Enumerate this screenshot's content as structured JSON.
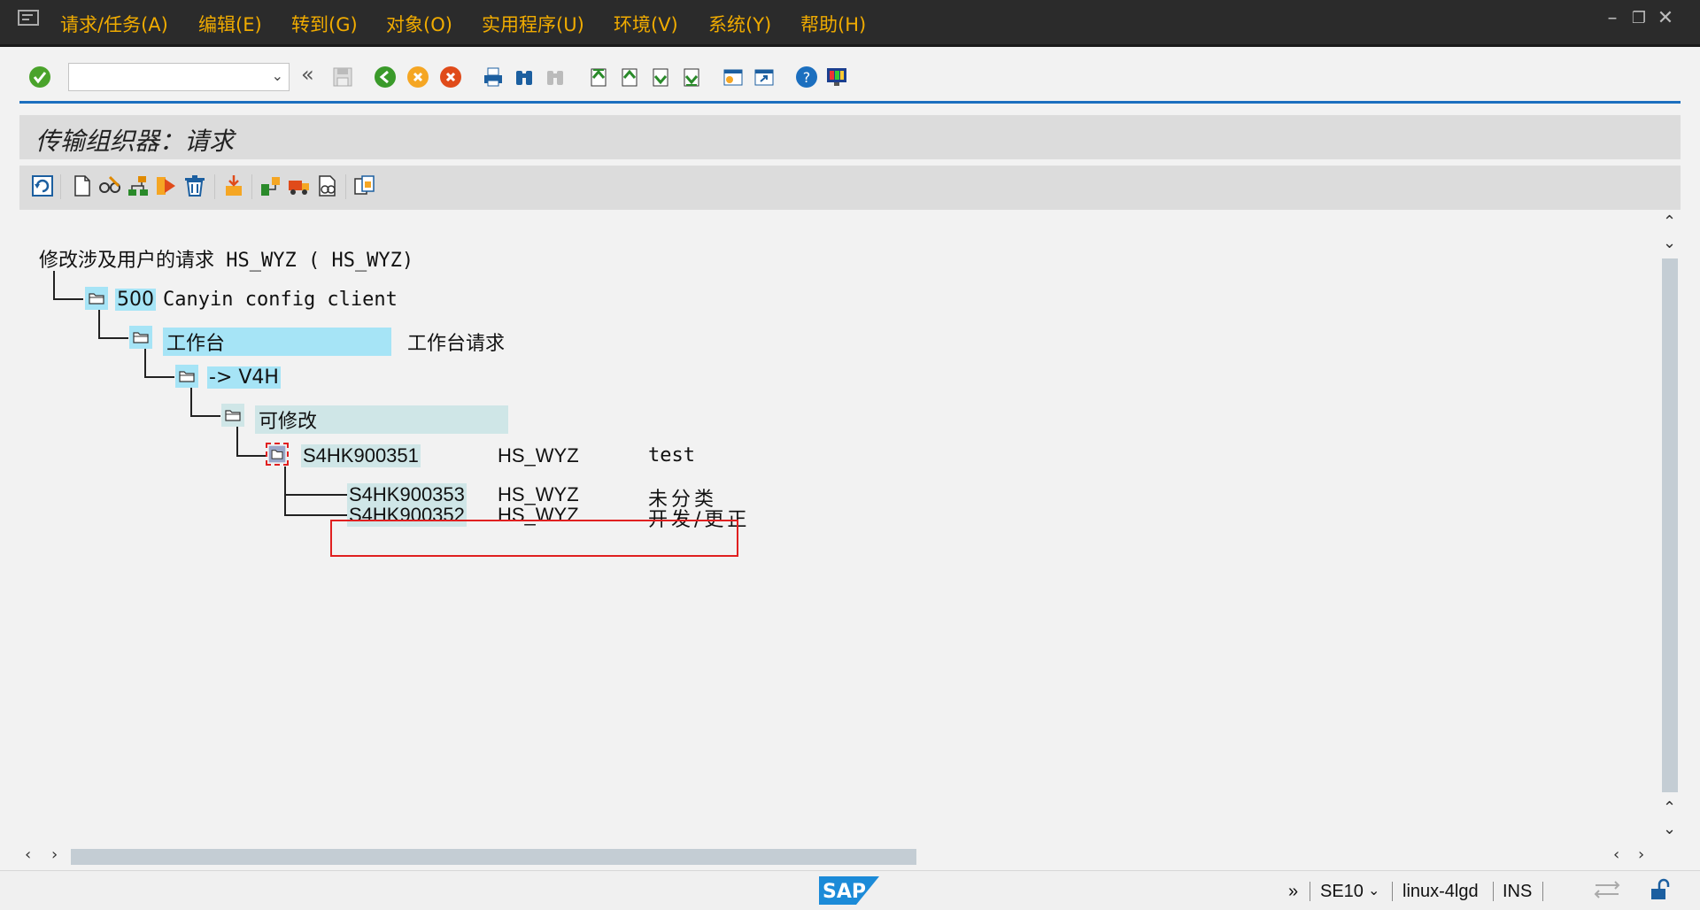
{
  "menu": {
    "items": [
      "请求/任务(A)",
      "编辑(E)",
      "转到(G)",
      "对象(O)",
      "实用程序(U)",
      "环境(V)",
      "系统(Y)",
      "帮助(H)"
    ]
  },
  "toolbar": {
    "command_value": ""
  },
  "page_title": "传输组织器：请求",
  "tree": {
    "root_label": "修改涉及用户的请求 HS_WYZ ( HS_WYZ)",
    "client_number": "500",
    "client_desc": "Canyin config client",
    "category": "工作台",
    "category_desc": "工作台请求",
    "target": "-> V4H",
    "status": "可修改",
    "request": {
      "id": "S4HK900351",
      "owner": "HS_WYZ",
      "desc": "test"
    },
    "tasks": [
      {
        "id": "S4HK900353",
        "owner": "HS_WYZ",
        "desc": "未分类"
      },
      {
        "id": "S4HK900352",
        "owner": "HS_WYZ",
        "desc": "开发/更正"
      }
    ]
  },
  "status_bar": {
    "logo": "SAP",
    "chevron": "»",
    "transaction": "SE10",
    "server": "linux-4lgd",
    "mode": "INS"
  },
  "colors": {
    "menu_text": "#f0ab00",
    "highlight": "#a6e4f6",
    "accent_line": "#1c6fbf",
    "callout": "#e02020"
  }
}
